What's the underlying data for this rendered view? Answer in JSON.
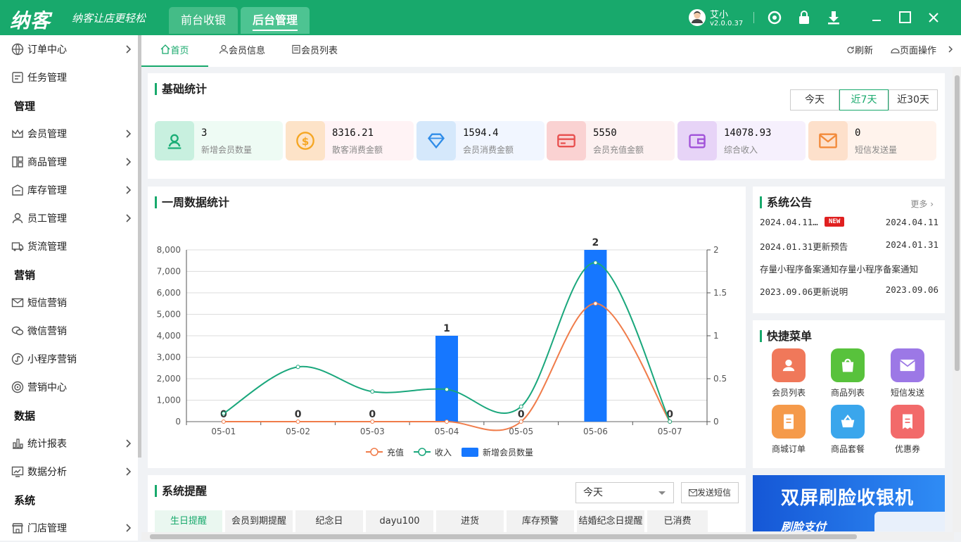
{
  "app": {
    "logo": "纳客",
    "slogan": "纳客让店更轻松",
    "tabs": [
      "前台收银",
      "后台管理"
    ],
    "active_tab": 1
  },
  "user": {
    "name": "艾小",
    "version": "v2.0.0.37"
  },
  "window_icons": [
    "refresh-icon",
    "lock-icon",
    "download-icon",
    "minimize-icon",
    "maximize-icon",
    "close-icon"
  ],
  "sidebar": {
    "items": [
      {
        "label": "订单中心",
        "icon": "globe-icon",
        "arrow": true
      },
      {
        "label": "任务管理",
        "icon": "task-icon",
        "arrow": false
      },
      {
        "group": "管理"
      },
      {
        "label": "会员管理",
        "icon": "crown-icon",
        "arrow": true
      },
      {
        "label": "商品管理",
        "icon": "grid-icon",
        "arrow": true
      },
      {
        "label": "库存管理",
        "icon": "warehouse-icon",
        "arrow": true
      },
      {
        "label": "员工管理",
        "icon": "person-icon",
        "arrow": true
      },
      {
        "label": "货流管理",
        "icon": "truck-icon",
        "arrow": false
      },
      {
        "group": "营销"
      },
      {
        "label": "短信营销",
        "icon": "mail-icon",
        "arrow": false
      },
      {
        "label": "微信营销",
        "icon": "wechat-icon",
        "arrow": false
      },
      {
        "label": "小程序营销",
        "icon": "miniprogram-icon",
        "arrow": false
      },
      {
        "label": "营销中心",
        "icon": "target-icon",
        "arrow": false
      },
      {
        "group": "数据"
      },
      {
        "label": "统计报表",
        "icon": "bar-chart-icon",
        "arrow": true
      },
      {
        "label": "数据分析",
        "icon": "analysis-icon",
        "arrow": true
      },
      {
        "group": "系统"
      },
      {
        "label": "门店管理",
        "icon": "store-icon",
        "arrow": true
      }
    ]
  },
  "page_tabs": [
    {
      "label": "首页",
      "icon": "home-icon"
    },
    {
      "label": "会员信息",
      "icon": "user-icon"
    },
    {
      "label": "会员列表",
      "icon": "list-icon"
    }
  ],
  "page_actions": {
    "refresh": "刷新",
    "page_ops": "页面操作"
  },
  "basic_stats": {
    "title": "基础统计",
    "ranges": [
      "今天",
      "近7天",
      "近30天"
    ],
    "selected_range": "近7天",
    "items": [
      {
        "value": "3",
        "label": "新增会员数量",
        "icon": "member-icon",
        "color": "#1aae76",
        "bg": "#eefbf4",
        "iconbg": "#c8f0df"
      },
      {
        "value": "8316.21",
        "label": "散客消费金额",
        "icon": "coin-icon",
        "color": "#f5a623",
        "bg": "#fff3f5",
        "iconbg": "#fde3c8"
      },
      {
        "value": "1594.4",
        "label": "会员消费金额",
        "icon": "diamond-icon",
        "color": "#2f8ce8",
        "bg": "#f1f6ff",
        "iconbg": "#d5e8fb"
      },
      {
        "value": "5550",
        "label": "会员充值金额",
        "icon": "card-icon",
        "color": "#e8504f",
        "bg": "#fdf1f1",
        "iconbg": "#fad2d2"
      },
      {
        "value": "14078.93",
        "label": "综合收入",
        "icon": "wallet-icon",
        "color": "#a152d9",
        "bg": "#f6f0fd",
        "iconbg": "#e7d4f7"
      },
      {
        "value": "0",
        "label": "短信发送量",
        "icon": "envelope-icon",
        "color": "#f28a3a",
        "bg": "#fff3ec",
        "iconbg": "#fde0cb"
      }
    ]
  },
  "weekly": {
    "title": "一周数据统计"
  },
  "chart_data": {
    "type": "bar",
    "categories": [
      "05-01",
      "05-02",
      "05-03",
      "05-04",
      "05-05",
      "05-06",
      "05-07"
    ],
    "series": [
      {
        "name": "充值",
        "type": "line",
        "axis": "left",
        "color": "#f07c4a",
        "values": [
          0,
          0,
          0,
          0,
          0,
          5500,
          0
        ]
      },
      {
        "name": "收入",
        "type": "line",
        "axis": "left",
        "color": "#1aa77c",
        "values": [
          380,
          2550,
          1400,
          1500,
          700,
          7400,
          0
        ]
      },
      {
        "name": "新增会员数量",
        "type": "bar",
        "axis": "right",
        "color": "#1677ff",
        "values": [
          0,
          0,
          0,
          1,
          0,
          2,
          0
        ]
      }
    ],
    "y_left": {
      "min": 0,
      "max": 8000,
      "ticks": [
        "0",
        "1,000",
        "2,000",
        "3,000",
        "4,000",
        "5,000",
        "6,000",
        "7,000",
        "8,000"
      ]
    },
    "y_right": {
      "min": 0,
      "max": 2,
      "ticks": [
        "0",
        "0.5",
        "1",
        "1.5",
        "2"
      ]
    },
    "grid": true,
    "legend": "bottom"
  },
  "notices": {
    "title": "系统公告",
    "more": "更多",
    "badge": "NEW",
    "items": [
      {
        "title": "2024.04.11…",
        "date": "2024.04.11",
        "new": true
      },
      {
        "title": "2024.01.31更新预告",
        "date": "2024.01.31"
      },
      {
        "title": "存量小程序备案通知存量小程序备案通知",
        "date": ""
      },
      {
        "title": "2023.09.06更新说明",
        "date": "2023.09.06"
      }
    ]
  },
  "quick_menu": {
    "title": "快捷菜单",
    "items": [
      {
        "label": "会员列表",
        "icon": "member-list-icon",
        "color": "#f0785a"
      },
      {
        "label": "商品列表",
        "icon": "shopping-bag-icon",
        "color": "#58c23c"
      },
      {
        "label": "短信发送",
        "icon": "sms-icon",
        "color": "#9c78e6"
      },
      {
        "label": "商城订单",
        "icon": "order-icon",
        "color": "#f59a4a"
      },
      {
        "label": "商品套餐",
        "icon": "basket-icon",
        "color": "#3aa6ec"
      },
      {
        "label": "优惠券",
        "icon": "coupon-icon",
        "color": "#f26a6a"
      }
    ]
  },
  "reminder": {
    "title": "系统提醒",
    "select": "今天",
    "send_sms": "发送短信",
    "tabs": [
      "生日提醒",
      "会员到期提醒",
      "纪念日",
      "dayu100",
      "进货",
      "库存预警",
      "结婚纪念日提醒",
      "已消费"
    ]
  },
  "banner": {
    "title": "双屏刷脸收银机",
    "sub": "刷脸支付"
  }
}
